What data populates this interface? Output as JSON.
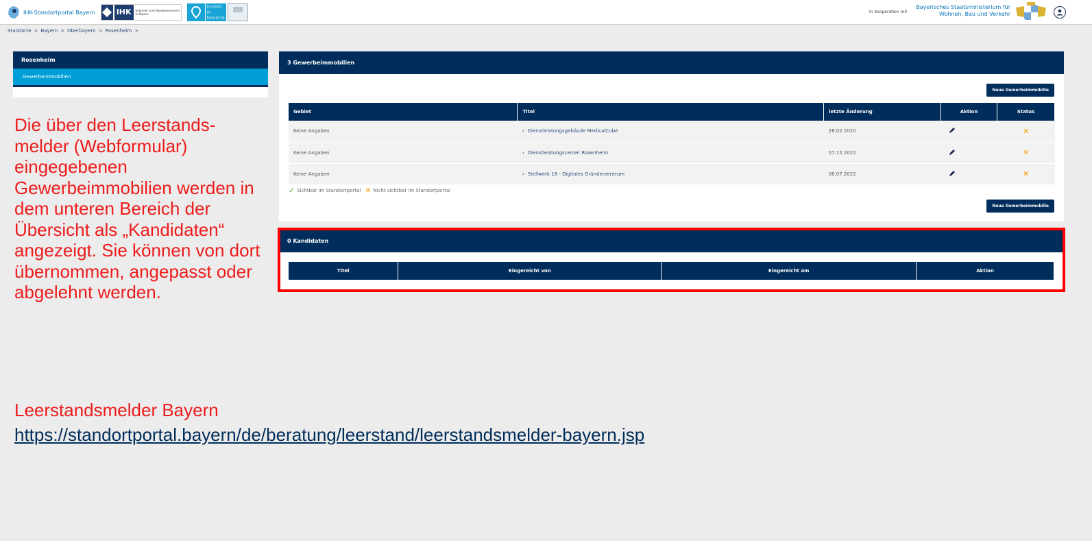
{
  "header": {
    "logo_ihk_standortportal": "IHK-Standortportal Bayern",
    "logo_ihk_box": "IHK",
    "logo_ihk_sub": "Industrie- und Handelskammern in Bayern",
    "logo_invest": "invest in bavaria",
    "kooperation": "In Kooperation mit",
    "ministry_line1": "Bayerisches Staatsministerium für",
    "ministry_line2": "Wohnen, Bau und Verkehr",
    "user_icon": "user-icon",
    "colors": {
      "navy": "#002d5b",
      "cyan": "#009ed6",
      "link_blue": "#0b74b8"
    }
  },
  "breadcrumb": {
    "items": [
      "Standorte",
      "Bayern",
      "Oberbayern",
      "Rosenheim"
    ],
    "separator": ">"
  },
  "sidebar": {
    "title": "Rosenheim",
    "item": "Gewerbeimmobilien"
  },
  "note": {
    "text": "Die über den Leerstands-melder (Webformular) eingegebenen Gewerbeimmobilien werden in dem unteren Bereich der Übersicht als „Kandidaten“ angezeigt. Sie können von dort übernommen, angepasst oder abgelehnt werden.",
    "title": "Leerstandsmelder Bayern",
    "link": "https://standortportal.bayern/de/beratung/leerstand/leerstandsmelder-bayern.jsp",
    "color": "#ee1c1c"
  },
  "immobilien": {
    "heading": "3 Gewerbeimmobilien",
    "new_button": "Neue Gewerbeimmobilie",
    "columns": [
      "Gebiet",
      "Titel",
      "letzte Änderung",
      "Aktion",
      "Status"
    ],
    "rows": [
      {
        "gebiet": "Keine Angaben",
        "titel": "Dienstleistungsgebäude MedicalCube",
        "datum": "28.02.2020"
      },
      {
        "gebiet": "Keine Angaben",
        "titel": "Dienstleistungscenter Rosenheim",
        "datum": "07.12.2022"
      },
      {
        "gebiet": "Keine Angaben",
        "titel": "Stellwerk 18 - Digitales Gründerzentrum",
        "datum": "06.07.2022"
      }
    ],
    "legend_visible": "Sichtbar im Standortportal",
    "legend_hidden": "Nicht sichtbar im Standortportal",
    "status_color": "#f3a300"
  },
  "kandidaten": {
    "heading": "0 Kandidaten",
    "columns": [
      "Titel",
      "Eingereicht von",
      "Eingereicht am",
      "Aktion"
    ],
    "highlight_color": "#ff0000"
  }
}
